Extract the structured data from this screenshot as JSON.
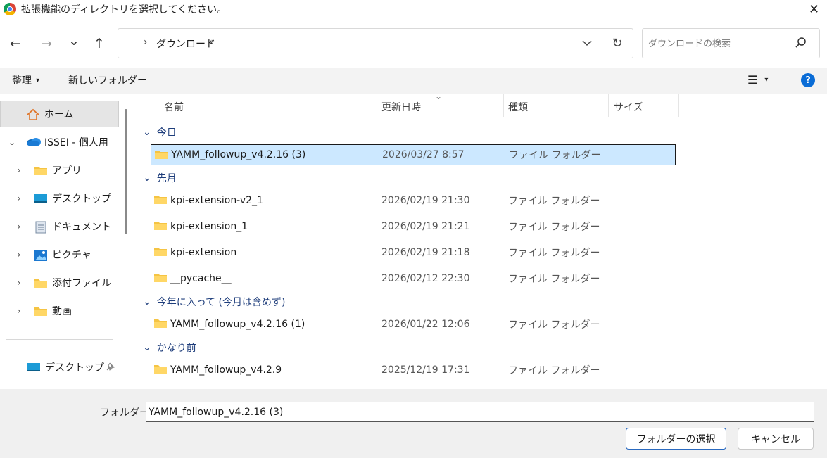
{
  "window": {
    "title": "拡張機能のディレクトリを選択してください。",
    "close_glyph": "✕"
  },
  "nav": {
    "back_glyph": "←",
    "forward_glyph": "→",
    "recent_glyph": "⌄",
    "up_glyph": "↑",
    "address_chevron": "›",
    "address_path": "ダウンロード",
    "refresh_glyph": "↻",
    "search_placeholder": "ダウンロードの検索"
  },
  "toolbar": {
    "organize_label": "整理",
    "organize_caret": "▾",
    "new_folder_label": "新しいフォルダー",
    "view_glyph": "☰",
    "view_caret": "▾",
    "help_label": "?"
  },
  "sidebar": {
    "items": [
      {
        "label": "ホーム",
        "icon": "home-icon"
      },
      {
        "label": "ISSEI - 個人用",
        "icon": "onedrive-icon",
        "expander": "⌄"
      },
      {
        "label": "アプリ",
        "icon": "folder-icon",
        "expander": "›"
      },
      {
        "label": "デスクトップ",
        "icon": "desktop-icon",
        "expander": "›"
      },
      {
        "label": "ドキュメント",
        "icon": "documents-icon",
        "expander": "›"
      },
      {
        "label": "ピクチャ",
        "icon": "pictures-icon",
        "expander": "›"
      },
      {
        "label": "添付ファイル",
        "icon": "folder-icon",
        "expander": "›"
      },
      {
        "label": "動画",
        "icon": "folder-icon",
        "expander": "›"
      }
    ],
    "quick_access": [
      {
        "label": "デスクトップ",
        "icon": "desktop-icon",
        "pin": "pin-icon"
      }
    ]
  },
  "columns": {
    "name": "名前",
    "modified": "更新日時",
    "type": "種類",
    "size": "サイズ",
    "sort_glyph": "⌄"
  },
  "groups": [
    {
      "label": "今日",
      "rows": [
        {
          "name": "YAMM_followup_v4.2.16 (3)",
          "date": "2026/03/27 8:57",
          "type": "ファイル フォルダー",
          "selected": true
        }
      ]
    },
    {
      "label": "先月",
      "rows": [
        {
          "name": "kpi-extension-v2_1",
          "date": "2026/02/19 21:30",
          "type": "ファイル フォルダー"
        },
        {
          "name": "kpi-extension_1",
          "date": "2026/02/19 21:21",
          "type": "ファイル フォルダー"
        },
        {
          "name": "kpi-extension",
          "date": "2026/02/19 21:18",
          "type": "ファイル フォルダー"
        },
        {
          "name": "__pycache__",
          "date": "2026/02/12 22:30",
          "type": "ファイル フォルダー"
        }
      ]
    },
    {
      "label": "今年に入って (今月は含めず)",
      "rows": [
        {
          "name": "YAMM_followup_v4.2.16 (1)",
          "date": "2026/01/22 12:06",
          "type": "ファイル フォルダー"
        }
      ]
    },
    {
      "label": "かなり前",
      "rows": [
        {
          "name": "YAMM_followup_v4.2.9",
          "date": "2025/12/19 17:31",
          "type": "ファイル フォルダー"
        }
      ]
    }
  ],
  "group_chevron": "⌄",
  "footer": {
    "folder_label": "フォルダー:",
    "folder_value": "YAMM_followup_v4.2.16 (3)",
    "select_button": "フォルダーの選択",
    "cancel_button": "キャンセル"
  },
  "colors": {
    "selection": "#cce8ff",
    "group_header": "#1e3d7b",
    "help": "#0a6cd6",
    "folder": "#f5c443"
  }
}
